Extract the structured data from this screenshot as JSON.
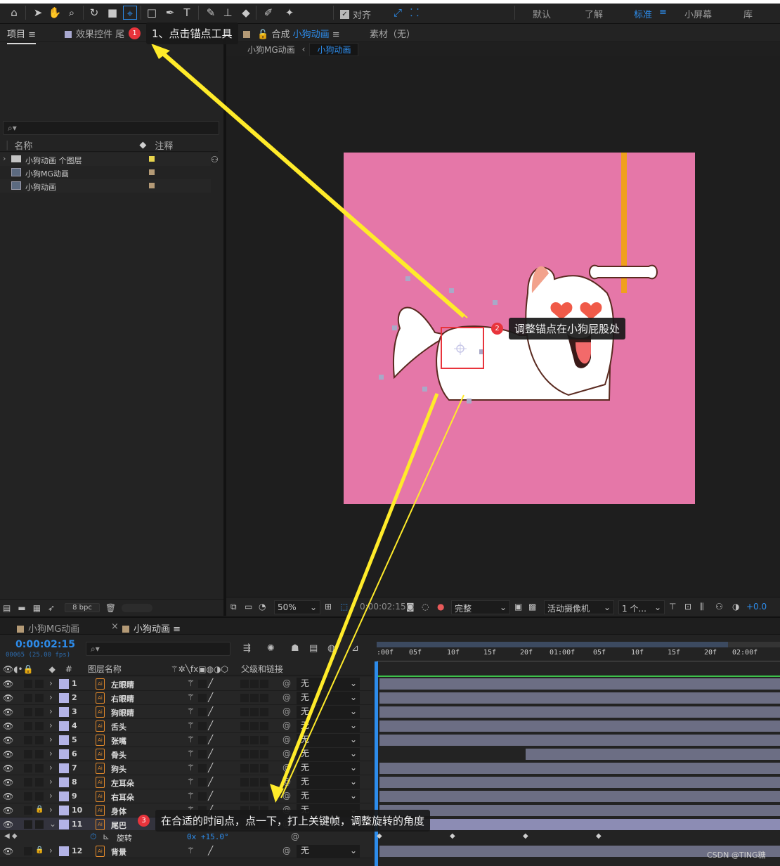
{
  "toolbar": {
    "snap_label": "对齐",
    "workspaces": [
      "默认",
      "了解",
      "标准",
      "小屏幕",
      "库"
    ],
    "active_workspace": "标准"
  },
  "project": {
    "tab_project": "项目",
    "tab_effects": "效果控件 尾",
    "search_placeholder": "",
    "col_name": "名称",
    "col_comment": "注释",
    "items": [
      {
        "name": "小狗动画 个图层",
        "type": "folder",
        "color": "#e8d44d"
      },
      {
        "name": "小狗MG动画",
        "type": "comp",
        "color": "#b49a76"
      },
      {
        "name": "小狗动画",
        "type": "comp",
        "color": "#b49a76"
      }
    ],
    "bpc": "8 bpc"
  },
  "comp": {
    "tab_prefix": "合成",
    "tab_name": "小狗动画",
    "footage_tab": "素材（无）",
    "breadcrumbs": [
      "小狗MG动画",
      "小狗动画"
    ],
    "zoom": "50%",
    "timecode": "0:00:02:15",
    "quality": "完整",
    "camera": "活动摄像机",
    "views": "1 个...",
    "exposure": "+0.0",
    "canvas_color": "#e577a8"
  },
  "timeline": {
    "tabs": [
      "小狗MG动画",
      "小狗动画"
    ],
    "current_time": "0:00:02:15",
    "frame_info": "00065 (25.00 fps)",
    "col_layer_name": "图层名称",
    "col_parent": "父级和链接",
    "col_hash": "#",
    "ruler": [
      ":00f",
      "05f",
      "10f",
      "15f",
      "20f",
      "01:00f",
      "05f",
      "10f",
      "15f",
      "20f",
      "02:00f"
    ],
    "layers": [
      {
        "num": "1",
        "name": "左眼睛",
        "parent": "无"
      },
      {
        "num": "2",
        "name": "右眼睛",
        "parent": "无"
      },
      {
        "num": "3",
        "name": "狗眼睛",
        "parent": "无"
      },
      {
        "num": "4",
        "name": "舌头",
        "parent": "无"
      },
      {
        "num": "5",
        "name": "张嘴",
        "parent": "无"
      },
      {
        "num": "6",
        "name": "骨头",
        "parent": "无"
      },
      {
        "num": "7",
        "name": "狗头",
        "parent": "无"
      },
      {
        "num": "8",
        "name": "左耳朵",
        "parent": "无"
      },
      {
        "num": "9",
        "name": "右耳朵",
        "parent": "无"
      },
      {
        "num": "10",
        "name": "身体",
        "parent": "无"
      },
      {
        "num": "11",
        "name": "尾巴",
        "parent": ""
      }
    ],
    "rotation_label": "旋转",
    "rotation_value": "0x +15.0°",
    "last_layer": {
      "num": "12",
      "name": "背景",
      "parent": "无"
    }
  },
  "annotations": {
    "step1_num": "1",
    "step1": "1、点击锚点工具",
    "step2_num": "2",
    "step2": "调整锚点在小狗屁股处",
    "step3_num": "3",
    "step3": "在合适的时间点，点一下，打上关键帧，调整旋转的角度"
  },
  "watermark": "CSDN @TING糖"
}
